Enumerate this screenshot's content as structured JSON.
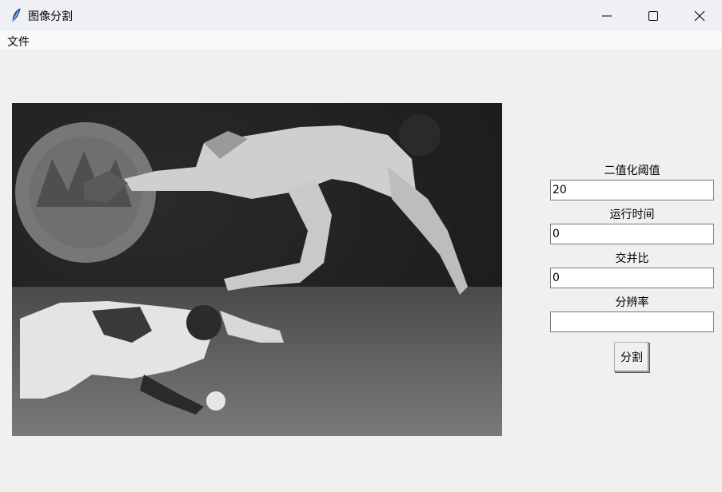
{
  "window": {
    "title": "图像分割"
  },
  "menu": {
    "file": "文件"
  },
  "panel": {
    "threshold_label": "二值化阈值",
    "threshold_value": "20",
    "runtime_label": "运行时间",
    "runtime_value": "0",
    "iou_label": "交并比",
    "iou_value": "0",
    "resolution_label": "分辨率",
    "resolution_value": "",
    "segment_button": "分割"
  },
  "icons": {
    "app": "feather-icon",
    "minimize": "minimize-icon",
    "maximize": "maximize-icon",
    "close": "close-icon"
  },
  "image": {
    "content": "photo"
  }
}
